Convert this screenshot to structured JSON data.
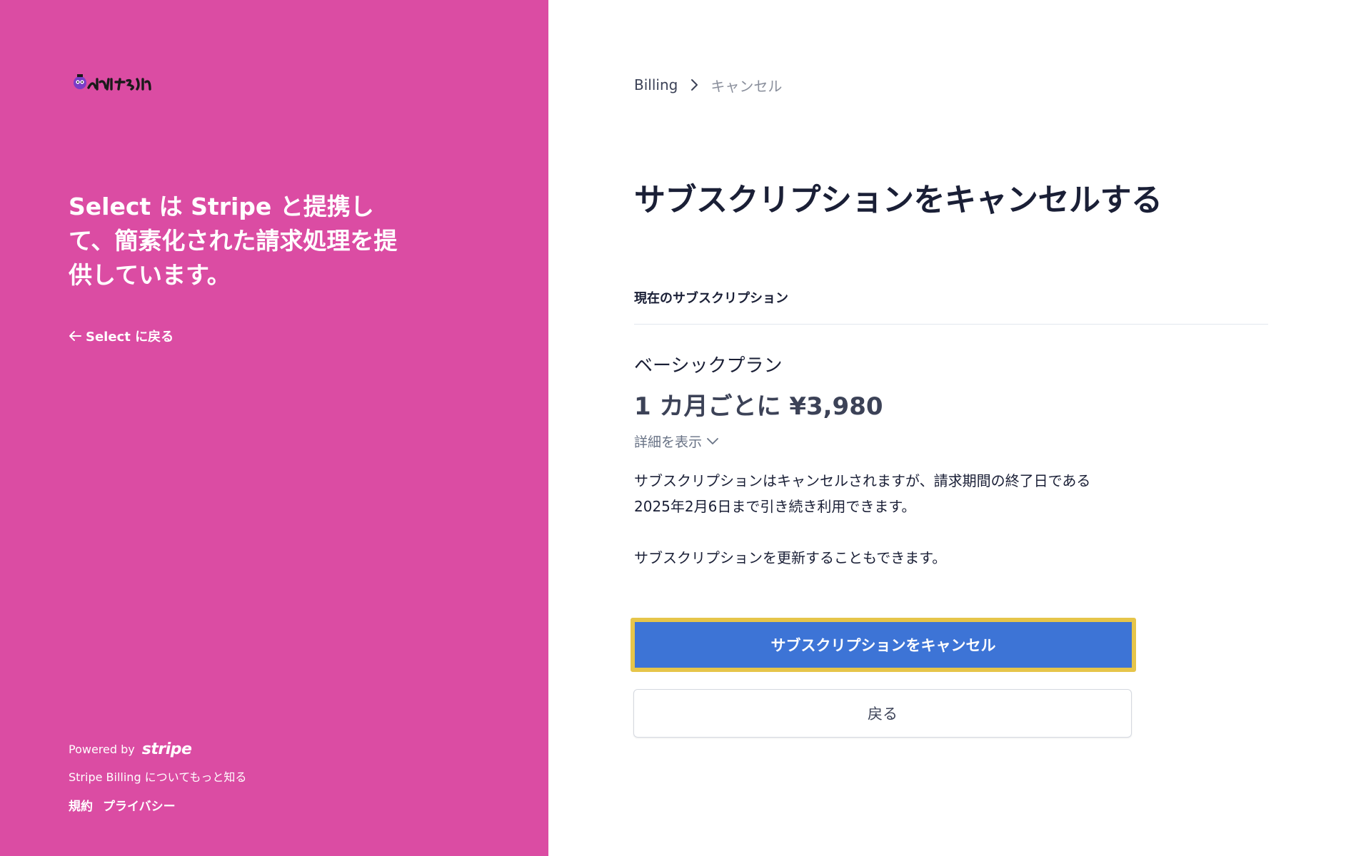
{
  "colors": {
    "left_bg": "#db4ca3",
    "primary_button": "#3d74d6",
    "highlight": "#e6c54a",
    "text_dark": "#1a1f36",
    "text_muted": "#697386"
  },
  "sidebar": {
    "logo_icon": "donbuzukun-logo",
    "logo_alt": "どんバズくん",
    "headline": "Select は Stripe と提携して、簡素化された請求処理を提供しています。",
    "back_link": "Select に戻る",
    "powered_by": "Powered by",
    "stripe_logo": "stripe",
    "learn_more": "Stripe Billing についてもっと知る",
    "footer_links": {
      "terms": "規約",
      "privacy": "プライバシー"
    }
  },
  "main": {
    "breadcrumb": {
      "parent": "Billing",
      "current": "キャンセル"
    },
    "title": "サブスクリプションをキャンセルする",
    "section_label": "現在のサブスクリプション",
    "plan": {
      "name": "ベーシックプラン",
      "price": "1 カ月ごとに ¥3,980",
      "details_toggle": "詳細を表示"
    },
    "cancel_info_line1": "サブスクリプションはキャンセルされますが、請求期間の終了日である",
    "cancel_info_line2": "2025年2月6日まで引き続き利用できます。",
    "renew_info": "サブスクリプションを更新することもできます。",
    "cancel_button": "サブスクリプションをキャンセル",
    "back_button": "戻る"
  }
}
